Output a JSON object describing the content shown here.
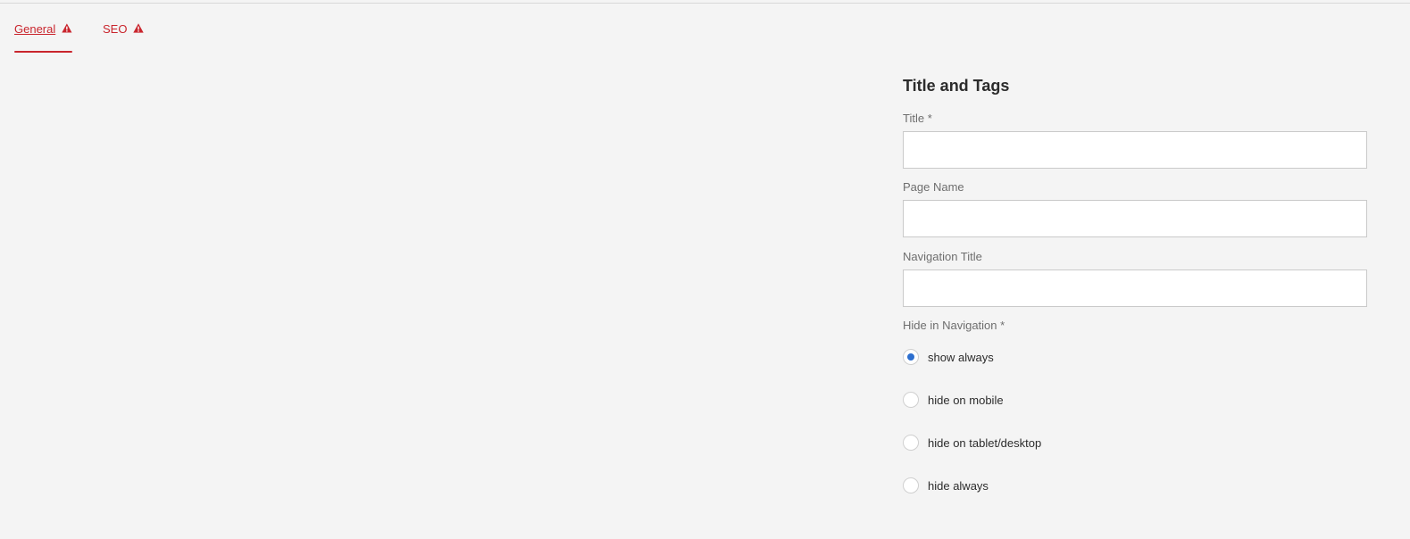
{
  "tabs": [
    {
      "label": "General",
      "icon": "alert-icon",
      "active": true
    },
    {
      "label": "SEO",
      "icon": "alert-icon",
      "active": false
    }
  ],
  "colors": {
    "accent": "#c9252d",
    "radio_checked": "#2d6fcf",
    "background": "#f4f4f4"
  },
  "form": {
    "section_title": "Title and Tags",
    "fields": {
      "title": {
        "label": "Title *",
        "value": ""
      },
      "page_name": {
        "label": "Page Name",
        "value": ""
      },
      "navigation_title": {
        "label": "Navigation Title",
        "value": ""
      }
    },
    "hide_in_navigation": {
      "label": "Hide in Navigation *",
      "selected": "show always",
      "options": [
        "show always",
        "hide on mobile",
        "hide on tablet/desktop",
        "hide always"
      ]
    }
  }
}
